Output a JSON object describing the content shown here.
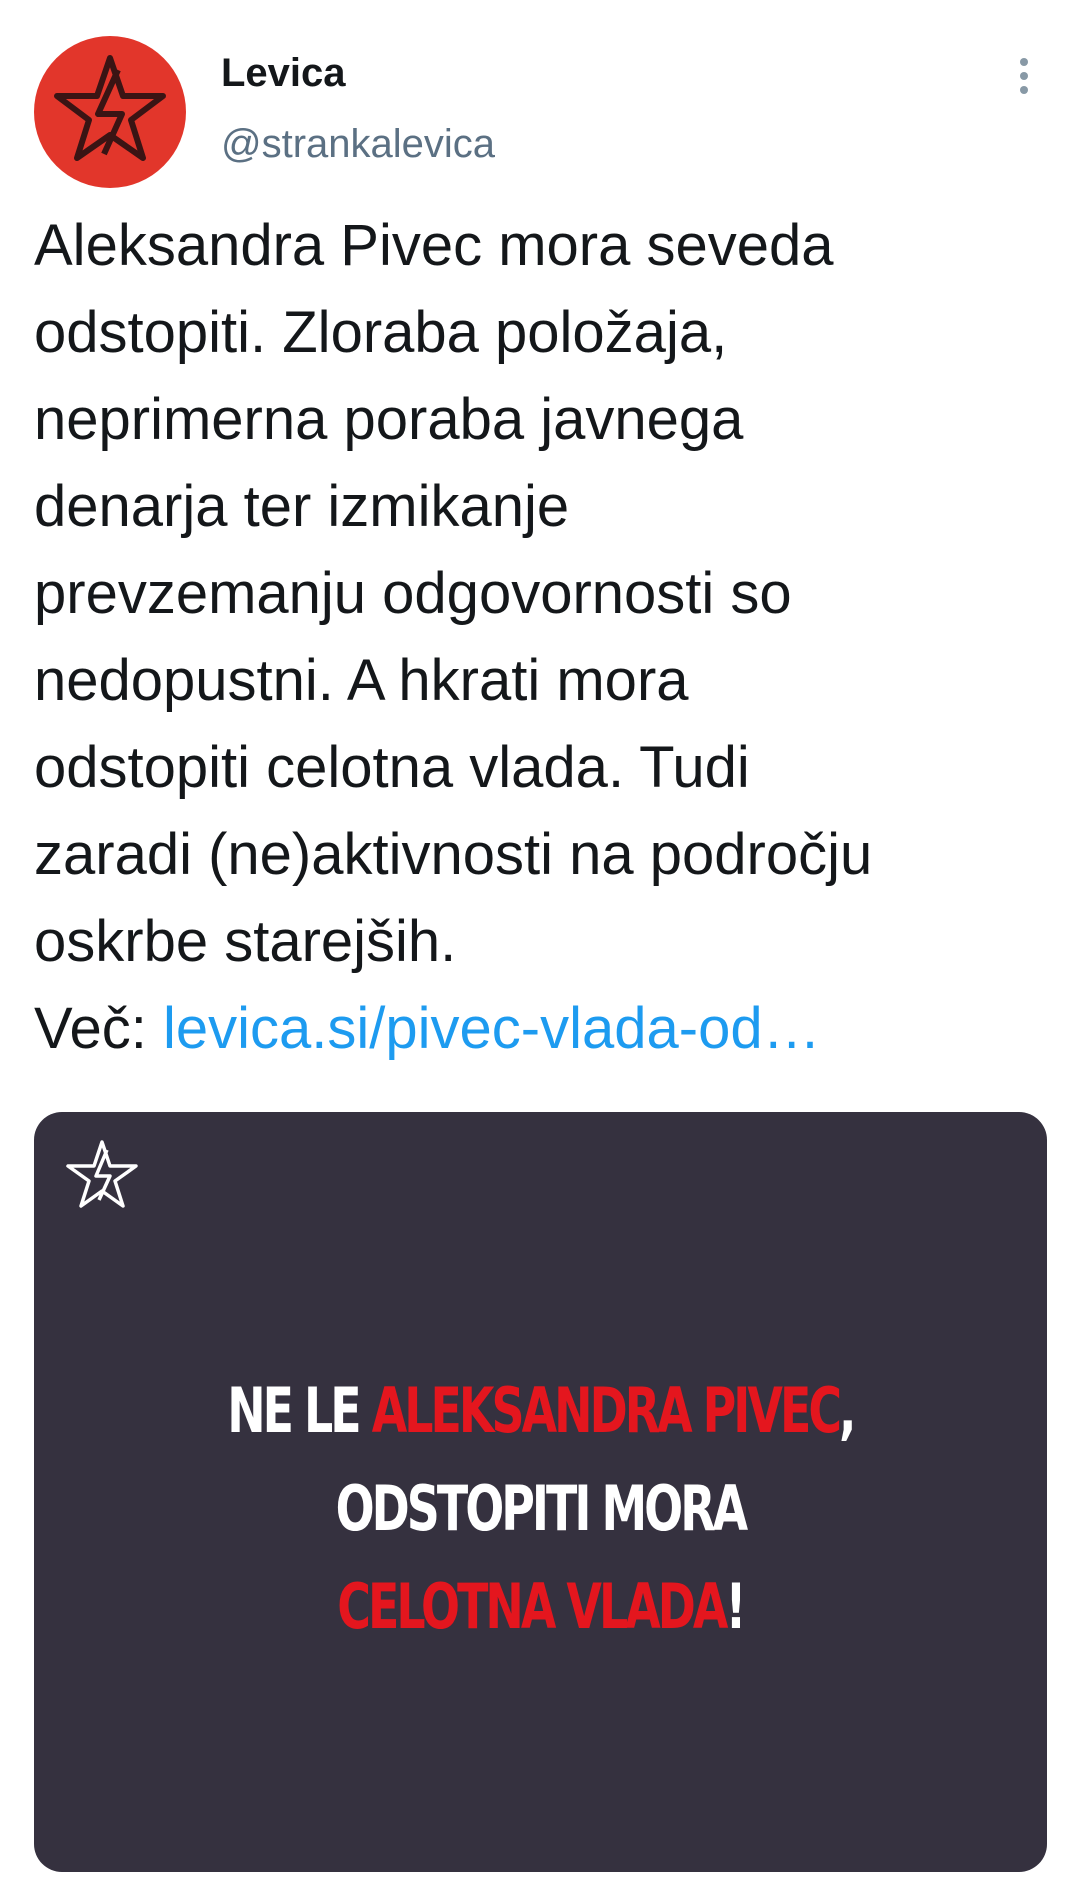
{
  "tweet": {
    "author": {
      "name": "Levica",
      "handle": "@strankalevica",
      "avatar_icon": "red-star-logo-icon",
      "avatar_color": "#e2362b"
    },
    "menu_icon": "more-vertical-icon",
    "text_lines": [
      "Aleksandra Pivec mora seveda",
      "odstopiti. Zloraba položaja,",
      "neprimerna poraba javnega",
      "denarja ter izmikanje",
      "prevzemanju odgovornosti so",
      "nedopustni. A hkrati mora",
      "odstopiti celotna vlada. Tudi",
      "zaradi (ne)aktivnosti na področju",
      "oskrbe starejših."
    ],
    "more_label": "Več: ",
    "link_text": "levica.si/pivec-vlada-od…",
    "link_color": "#1d9bf0"
  },
  "media": {
    "background_color": "#35313f",
    "logo_icon": "white-star-logo-icon",
    "headline": {
      "line1_white": "NE LE ",
      "line1_red": "ALEKSANDRA PIVEC",
      "line1_end": ",",
      "line2": "ODSTOPITI MORA",
      "line3_red": "CELOTNA VLADA",
      "line3_end": "!"
    },
    "accent_red": "#e4161e"
  }
}
